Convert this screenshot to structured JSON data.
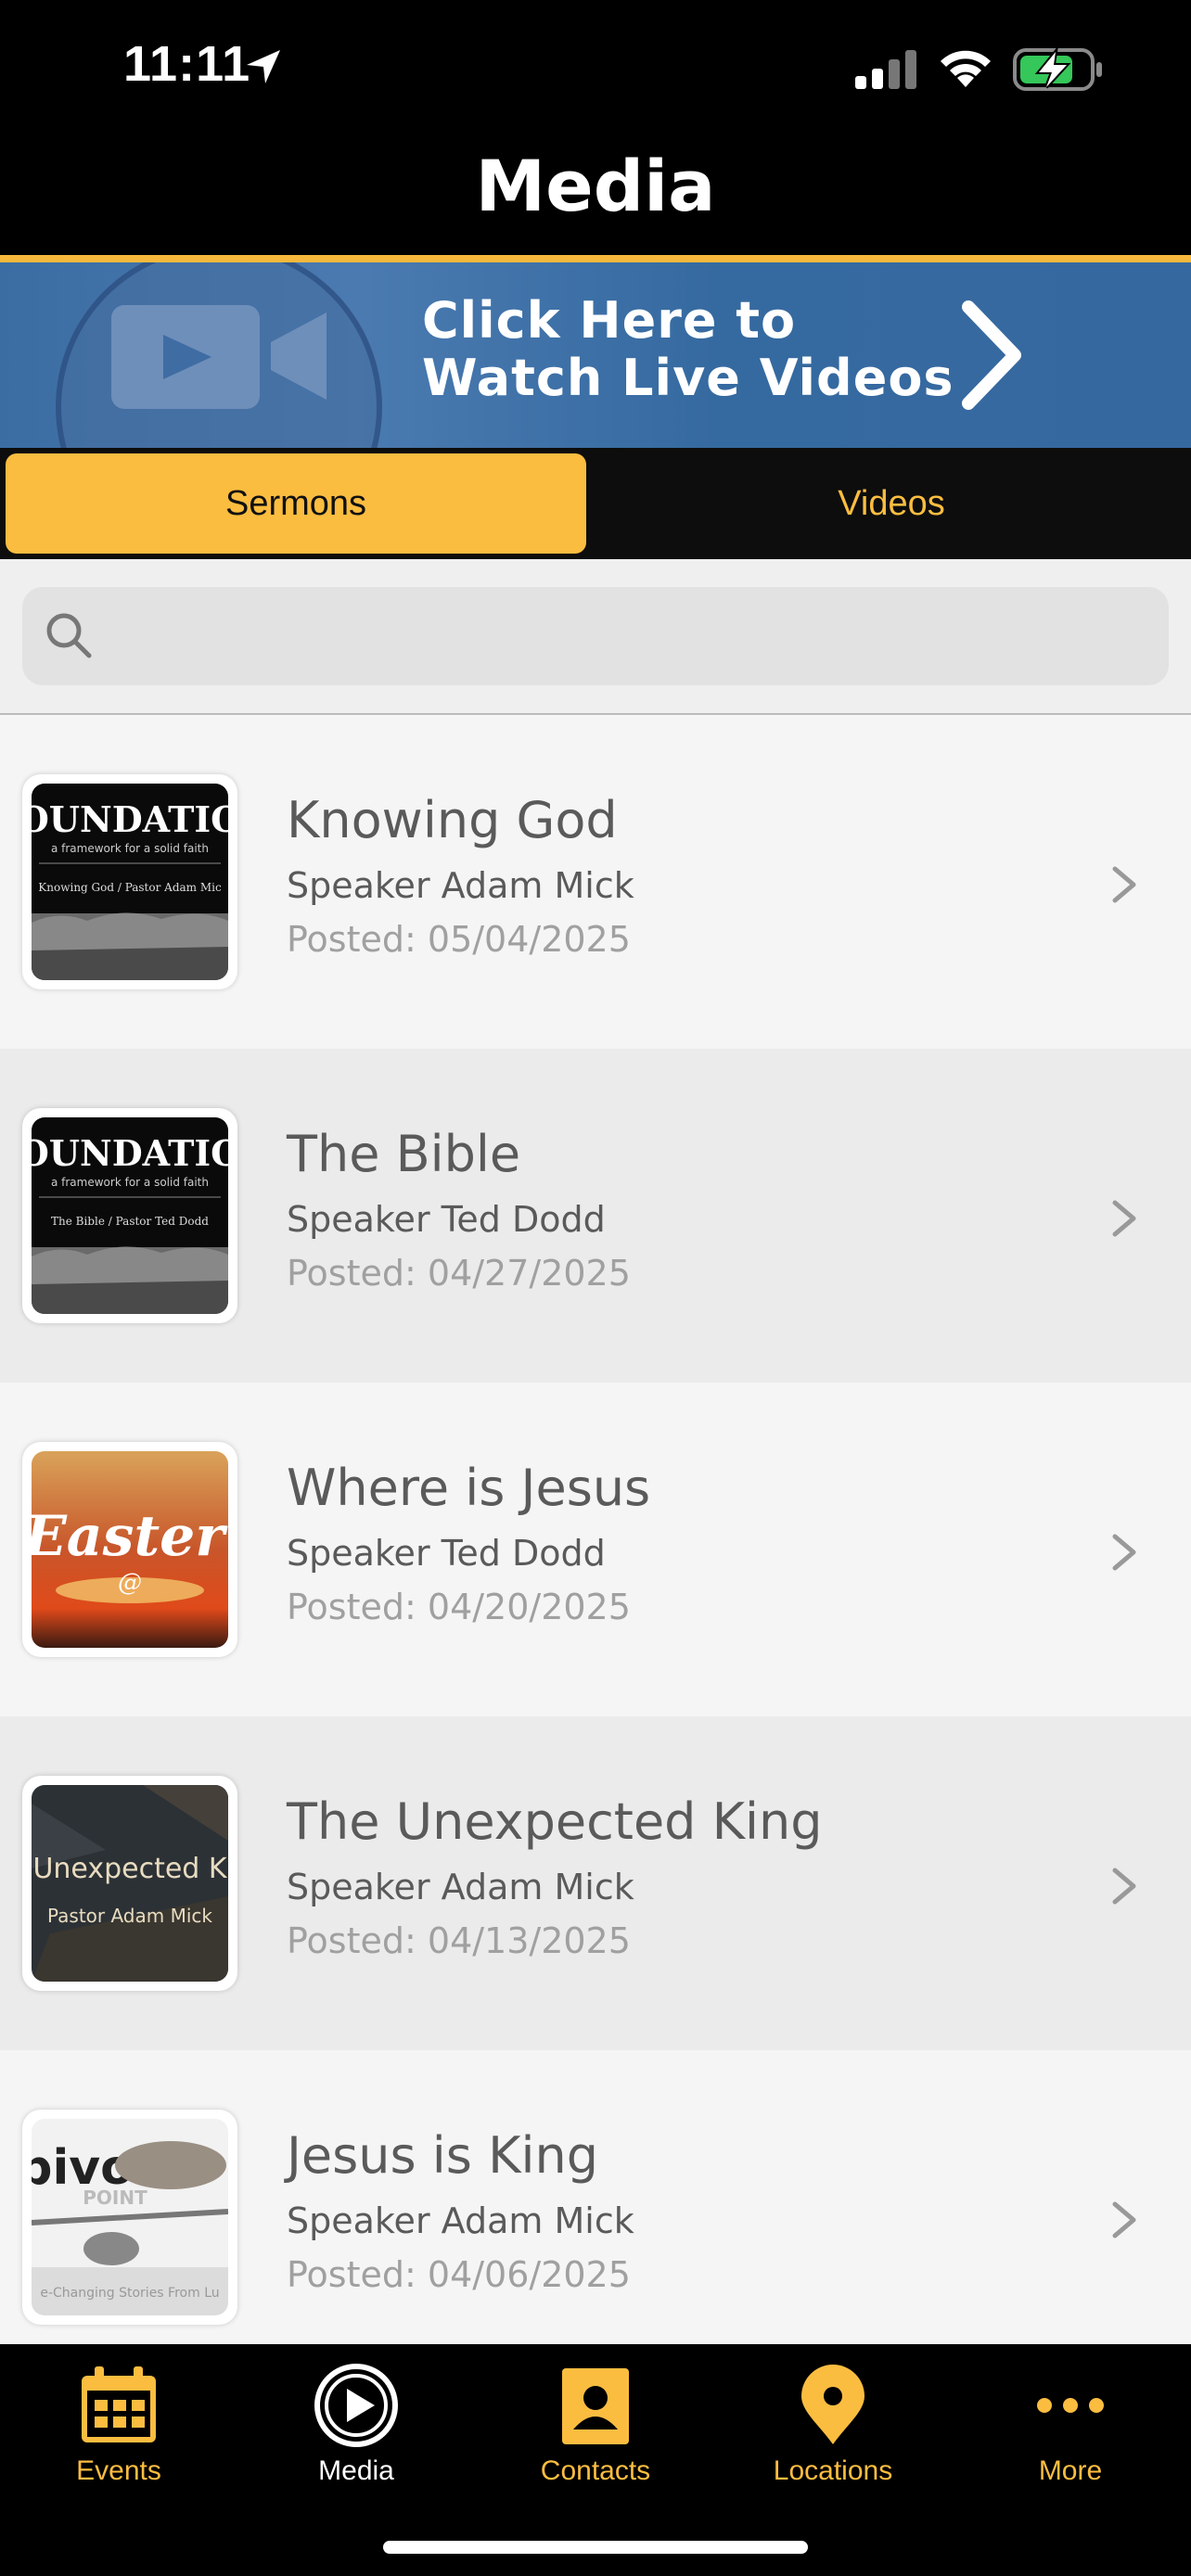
{
  "status": {
    "time": "11:11"
  },
  "nav": {
    "title": "Media"
  },
  "banner": {
    "line1": "Click Here to",
    "line2": "Watch Live Videos"
  },
  "tabs": {
    "sermons": "Sermons",
    "videos": "Videos"
  },
  "search": {
    "placeholder": "",
    "value": ""
  },
  "sermons": [
    {
      "title": "Knowing God",
      "speaker": "Speaker Adam Mick",
      "posted": "Posted: 05/04/2025",
      "thumb_top": "OUNDATIO",
      "thumb_sub": "a framework for a solid faith",
      "thumb_line": "Knowing God  /  Pastor Adam Mic"
    },
    {
      "title": "The Bible",
      "speaker": "Speaker Ted Dodd",
      "posted": "Posted: 04/27/2025",
      "thumb_top": "OUNDATIO",
      "thumb_sub": "a framework for a solid faith",
      "thumb_line": "The Bible  /  Pastor Ted Dodd"
    },
    {
      "title": "Where is Jesus",
      "speaker": "Speaker Ted Dodd",
      "posted": "Posted: 04/20/2025",
      "thumb_top": "Easter",
      "thumb_sub": "@",
      "thumb_line": ""
    },
    {
      "title": "The Unexpected King",
      "speaker": "Speaker Adam Mick",
      "posted": "Posted: 04/13/2025",
      "thumb_top": "Unexpected K",
      "thumb_sub": "Pastor Adam Mick",
      "thumb_line": ""
    },
    {
      "title": "Jesus is King",
      "speaker": "Speaker Adam Mick",
      "posted": "Posted: 04/06/2025",
      "thumb_top": "pivot",
      "thumb_sub": "POINT",
      "thumb_line": "e-Changing Stories From Lu"
    }
  ],
  "tabbar": {
    "events": "Events",
    "media": "Media",
    "contacts": "Contacts",
    "locations": "Locations",
    "more": "More"
  },
  "colors": {
    "accent": "#fbbd40",
    "banner": "#3b6da3",
    "bar": "#000000"
  }
}
